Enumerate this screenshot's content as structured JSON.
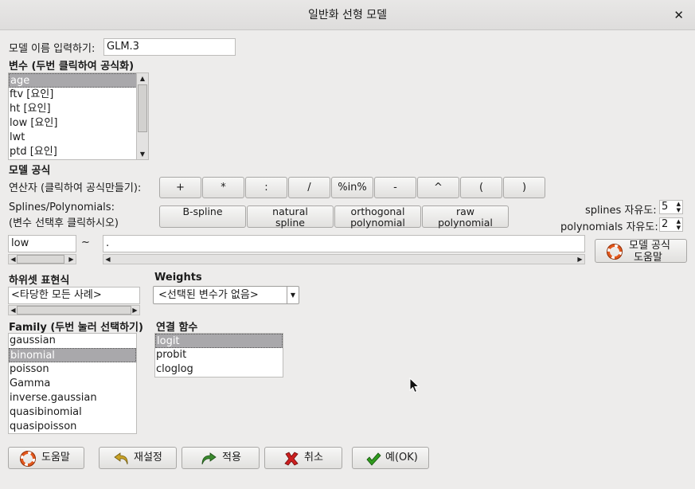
{
  "window": {
    "title": "일반화 선형 모델",
    "close": "✕"
  },
  "model_name": {
    "label": "모델 이름 입력하기:",
    "value": "GLM.3"
  },
  "variables": {
    "label": "변수 (두번 클릭하여 공식화)",
    "items": [
      "age",
      "ftv [요인]",
      "ht [요인]",
      "low [요인]",
      "lwt",
      "ptd [요인]"
    ],
    "selected": "age"
  },
  "formula": {
    "section_label": "모델 공식",
    "operators_label": "연산자 (클릭하여 공식만들기):",
    "operators": [
      "+",
      "*",
      ":",
      "/",
      "%in%",
      "-",
      "^",
      "(",
      ")"
    ],
    "splines_label_1": "Splines/Polynomials:",
    "splines_label_2": "(변수 선택후 클릭하시오)",
    "spline_buttons": [
      [
        "B-spline",
        ""
      ],
      [
        "natural",
        "spline"
      ],
      [
        "orthogonal",
        "polynomial"
      ],
      [
        "raw",
        "polynomial"
      ]
    ],
    "splines_df_label": "splines 자유도:",
    "splines_df_value": "5",
    "poly_df_label": "polynomials 자유도:",
    "poly_df_value": "2",
    "lhs": "low",
    "tilde": "~",
    "rhs": ".",
    "help_line1": "모델 공식",
    "help_line2": "도움말"
  },
  "subset": {
    "label": "하위셋 표현식",
    "value": "<타당한 모든 사례>"
  },
  "weights": {
    "label": "Weights",
    "value": "<선택된 변수가 없음>"
  },
  "family": {
    "label": "Family (두번 눌러 선택하기)",
    "items": [
      "gaussian",
      "binomial",
      "poisson",
      "Gamma",
      "inverse.gaussian",
      "quasibinomial",
      "quasipoisson"
    ],
    "selected": "binomial"
  },
  "link": {
    "label": "연결 함수",
    "items": [
      "logit",
      "probit",
      "cloglog"
    ],
    "selected": "logit"
  },
  "buttons": {
    "help": "도움말",
    "reset": "재설정",
    "apply": "적용",
    "cancel": "취소",
    "ok": "예(OK)"
  },
  "icons": {
    "help": "lifebuoy-icon",
    "reset": "undo-arrow-icon",
    "apply": "redo-arrow-icon",
    "cancel": "red-x-icon",
    "ok": "green-check-icon"
  },
  "colors": {
    "selection": "#a9a8ab",
    "lifebuoy": "#e2571c",
    "undo": "#c9a227",
    "redo": "#3a8a2e",
    "cancel": "#cc1f1f",
    "ok": "#2f9b1e"
  }
}
